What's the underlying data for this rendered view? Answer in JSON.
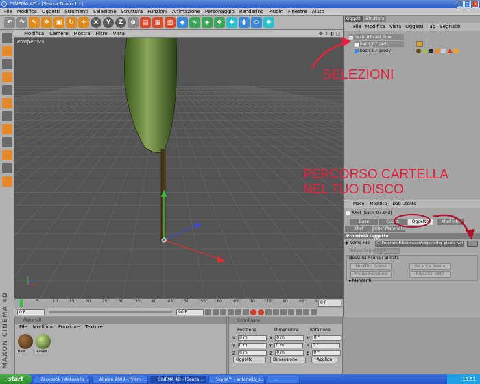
{
  "window": {
    "title": "CINEMA 4D - [Senza Titolo 1 *]"
  },
  "menubar": [
    "File",
    "Modifica",
    "Oggetti",
    "Strumenti",
    "Selezione",
    "Struttura",
    "Funzioni",
    "Animazione",
    "Personaggio",
    "Rendering",
    "Plugin",
    "Finestre",
    "Aiuto"
  ],
  "viewport": {
    "menu": [
      "Modifica",
      "Camere",
      "Mostra",
      "Filtro",
      "Vista"
    ],
    "label": "Prospettiva"
  },
  "timeline": {
    "ticks": [
      "0",
      "5",
      "10",
      "15",
      "20",
      "25",
      "30",
      "35",
      "40",
      "45",
      "50",
      "55",
      "60",
      "65",
      "70",
      "75",
      "80",
      "85",
      "90"
    ],
    "frame_field": "0 F",
    "start_field": "0 F",
    "end_field": "90 F"
  },
  "materials": {
    "title": "Materiali",
    "menu": [
      "File",
      "Modifica",
      "Funzione",
      "Texture"
    ],
    "items": [
      "bark",
      "leaves"
    ]
  },
  "coordinates": {
    "title": "Coordinate",
    "headers": [
      "Posizione",
      "Dimensione",
      "Rotazione"
    ],
    "rows": [
      {
        "axis": "X",
        "pos": "0 m",
        "dim": "0 m",
        "rotl": "H",
        "rot": "0 °"
      },
      {
        "axis": "Y",
        "pos": "0 m",
        "dim": "0 m",
        "rotl": "P",
        "rot": "0 °"
      },
      {
        "axis": "Z",
        "pos": "0 m",
        "dim": "0 m",
        "rotl": "B",
        "rot": "0 °"
      }
    ],
    "mode_select": "Oggetto",
    "size_select": "Dimensione",
    "apply": "Applica"
  },
  "objects": {
    "tabs": [
      "Oggetti",
      "Struttura"
    ],
    "menu": [
      "File",
      "Modifica",
      "Vista",
      "Oggetti",
      "Tag",
      "Segnalib"
    ],
    "rows": [
      {
        "name": "bach_07.c4d_Prox",
        "selected": true
      },
      {
        "name": "bach_07.c4d",
        "selected": true
      },
      {
        "name": "bach_07_proxy",
        "selected": false
      }
    ]
  },
  "attributes": {
    "menu": [
      "Modo",
      "Modifica",
      "Dati Utente"
    ],
    "object_name": "XRef [bach_07.c4d]",
    "tabs": [
      "Base",
      "Coord.",
      "Oggetto",
      "XRef Info"
    ],
    "tabs2": [
      "XRef Oggetto",
      "XRef Materiale"
    ],
    "section": "Proprietà Oggetto",
    "file_label": "Nome File",
    "file_path": "C:\\Program Files\\maxon\\objects\\hq_plants_vol",
    "time_label": "Tempo Scena",
    "time_value": "0/1 F",
    "no_scene": "Nessuna Scena Caricata",
    "btn_modifica": "Modifica Scena",
    "btn_ricarica": "Ricarica Scena",
    "btn_prendi": "Prendi Selezione",
    "btn_ricarica_tutto": "Ricarica Tutto",
    "mancanti": "Mancanti"
  },
  "annotations": {
    "selezioni": "SELEZIONI",
    "percorso_line1": "PERCORSO CARTELLA",
    "percorso_line2": "NEL TUO DISCO",
    "color": "#e8203c"
  },
  "taskbar": {
    "start": "start",
    "tasks": [
      "Facebook | Antonello ...",
      "Allplan 2009 - Prism - ...",
      "CINEMA 4D - [Senza ...",
      "Skype™ - antonello_s...",
      "..."
    ],
    "clock": "15.51"
  },
  "side_logo": "MAXON CINEMA 4D"
}
